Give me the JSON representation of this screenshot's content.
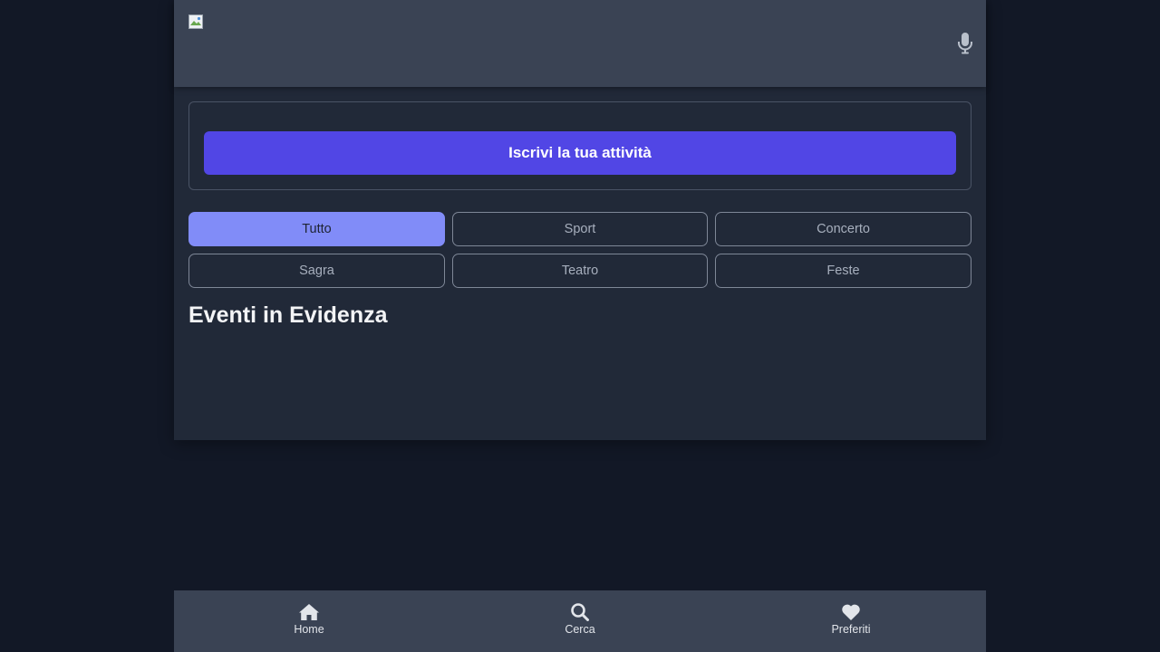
{
  "header": {
    "logo_alt": "logo",
    "mic_icon": "microphone-icon"
  },
  "cta": {
    "label": "Iscrivi la tua attività"
  },
  "categories": [
    {
      "label": "Tutto",
      "active": true
    },
    {
      "label": "Sport",
      "active": false
    },
    {
      "label": "Concerto",
      "active": false
    },
    {
      "label": "Sagra",
      "active": false
    },
    {
      "label": "Teatro",
      "active": false
    },
    {
      "label": "Feste",
      "active": false
    }
  ],
  "section": {
    "title": "Eventi in Evidenza"
  },
  "bottom_nav": {
    "items": [
      {
        "label": "Home",
        "icon": "home-icon"
      },
      {
        "label": "Cerca",
        "icon": "search-icon"
      },
      {
        "label": "Preferiti",
        "icon": "heart-icon"
      }
    ]
  },
  "colors": {
    "page_bg": "#121826",
    "panel_bg": "#212938",
    "header_bg": "#3a4354",
    "accent": "#5146e5",
    "chip_active": "#818cf8"
  }
}
